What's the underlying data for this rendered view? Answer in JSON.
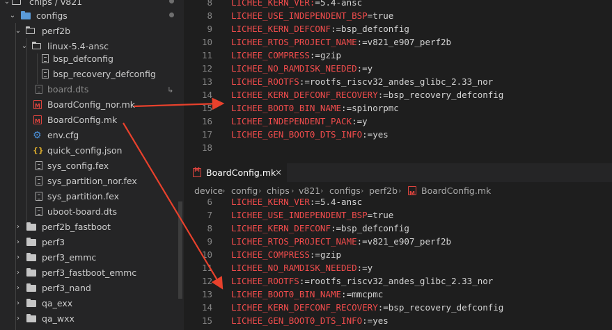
{
  "explorer": {
    "items": [
      {
        "label": "chips / v821"
      },
      {
        "label": "configs"
      },
      {
        "label": "perf2b"
      },
      {
        "label": "linux-5.4-ansc"
      },
      {
        "label": "bsp_defconfig"
      },
      {
        "label": "bsp_recovery_defconfig"
      },
      {
        "label": "board.dts"
      },
      {
        "label": "BoardConfig_nor.mk"
      },
      {
        "label": "BoardConfig.mk"
      },
      {
        "label": "env.cfg"
      },
      {
        "label": "quick_config.json"
      },
      {
        "label": "sys_config.fex"
      },
      {
        "label": "sys_partition_nor.fex"
      },
      {
        "label": "sys_partition.fex"
      },
      {
        "label": "uboot-board.dts"
      },
      {
        "label": "perf2b_fastboot"
      },
      {
        "label": "perf3"
      },
      {
        "label": "perf3_emmc"
      },
      {
        "label": "perf3_fastboot_emmc"
      },
      {
        "label": "perf3_nand"
      },
      {
        "label": "qa_exx"
      },
      {
        "label": "qa_wxx"
      }
    ]
  },
  "editor_top": {
    "lines": [
      {
        "ln": "8",
        "key": "LICHEE_KERN_VER:",
        "val": "=5.4-ansc"
      },
      {
        "ln": "8",
        "key": "LICHEE_USE_INDEPENDENT_BSP",
        "val": "=true"
      },
      {
        "ln": "9",
        "key": "LICHEE_KERN_DEFCONF",
        "val": ":=bsp_defconfig"
      },
      {
        "ln": "10",
        "key": "LICHEE_RTOS_PROJECT_NAME",
        "val": ":=v821_e907_perf2b"
      },
      {
        "ln": "11",
        "key": "LICHEE_COMPRESS",
        "val": ":=gzip"
      },
      {
        "ln": "12",
        "key": "LICHEE_NO_RAMDISK_NEEDED",
        "val": ":=y"
      },
      {
        "ln": "13",
        "key": "LICHEE_ROOTFS",
        "val": ":=rootfs_riscv32_andes_glibc_2.33_nor"
      },
      {
        "ln": "14",
        "key": "LICHEE_KERN_DEFCONF_RECOVERY",
        "val": ":=bsp_recovery_defconfig"
      },
      {
        "ln": "15",
        "key": "LICHEE_BOOT0_BIN_NAME",
        "val": ":=spinorpmc"
      },
      {
        "ln": "16",
        "key": "LICHEE_INDEPENDENT_PACK",
        "val": ":=y"
      },
      {
        "ln": "17",
        "key": "LICHEE_GEN_BOOT0_DTS_INFO",
        "val": ":=yes"
      },
      {
        "ln": "18",
        "key": "",
        "val": ""
      }
    ]
  },
  "tab": {
    "label": "BoardConfig.mk",
    "close": "×"
  },
  "breadcrumb": [
    "device",
    "config",
    "chips",
    "v821",
    "configs",
    "perf2b",
    "BoardConfig.mk"
  ],
  "breadcrumb_sep": "›",
  "editor_bottom": {
    "lines": [
      {
        "ln": "6",
        "key": "LICHEE_KERN_VER",
        "val": ":=5.4-ansc"
      },
      {
        "ln": "7",
        "key": "LICHEE_USE_INDEPENDENT_BSP",
        "val": "=true"
      },
      {
        "ln": "8",
        "key": "LICHEE_KERN_DEFCONF",
        "val": ":=bsp_defconfig"
      },
      {
        "ln": "9",
        "key": "LICHEE_RTOS_PROJECT_NAME",
        "val": ":=v821_e907_perf2b"
      },
      {
        "ln": "10",
        "key": "LICHEE_COMPRESS",
        "val": ":=gzip"
      },
      {
        "ln": "11",
        "key": "LICHEE_NO_RAMDISK_NEEDED",
        "val": ":=y"
      },
      {
        "ln": "12",
        "key": "LICHEE_ROOTFS",
        "val": ":=rootfs_riscv32_andes_glibc_2.33_nor"
      },
      {
        "ln": "13",
        "key": "LICHEE_BOOT0_BIN_NAME",
        "val": ":=mmcpmc"
      },
      {
        "ln": "14",
        "key": "LICHEE_KERN_DEFCONF_RECOVERY",
        "val": ":=bsp_recovery_defconfig"
      },
      {
        "ln": "15",
        "key": "LICHEE_GEN_BOOT0_DTS_INFO",
        "val": ":=yes"
      }
    ]
  },
  "colors": {
    "annotation_arrow": "#e8412c",
    "key": "#f14c4c",
    "mk_icon": "#e0443e"
  }
}
